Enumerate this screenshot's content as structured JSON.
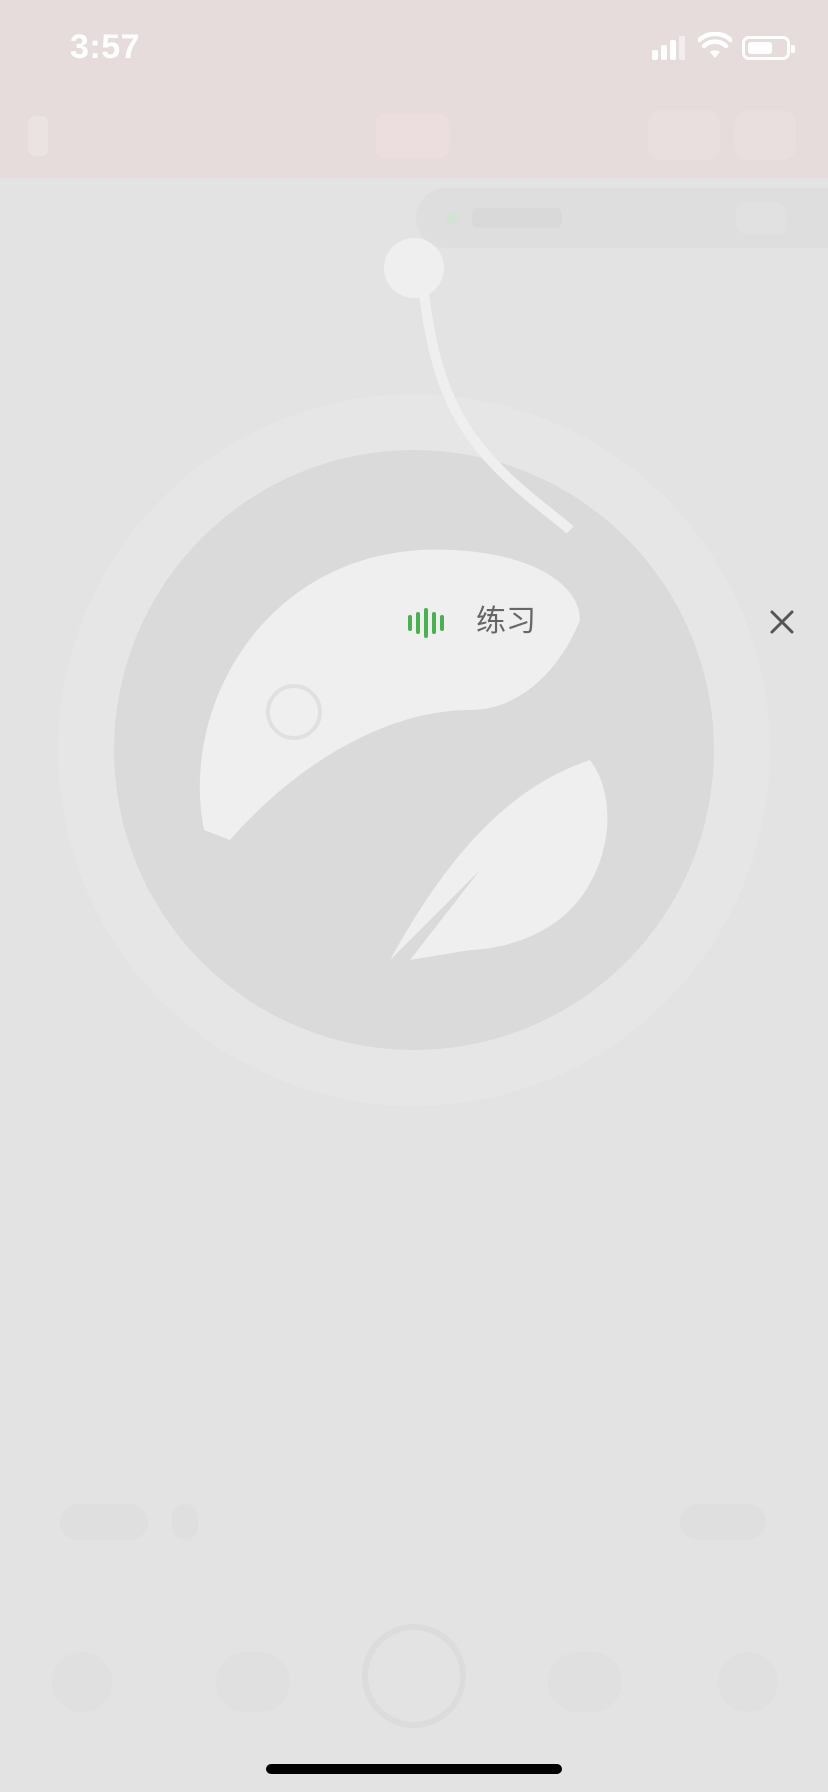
{
  "status_bar": {
    "time": "3:57"
  },
  "overlay": {
    "title": "练习"
  },
  "colors": {
    "accent": "#4caf50",
    "status_bar_bg": "#e7dcdc",
    "background": "#e3e3e3",
    "title_text": "#666666"
  }
}
